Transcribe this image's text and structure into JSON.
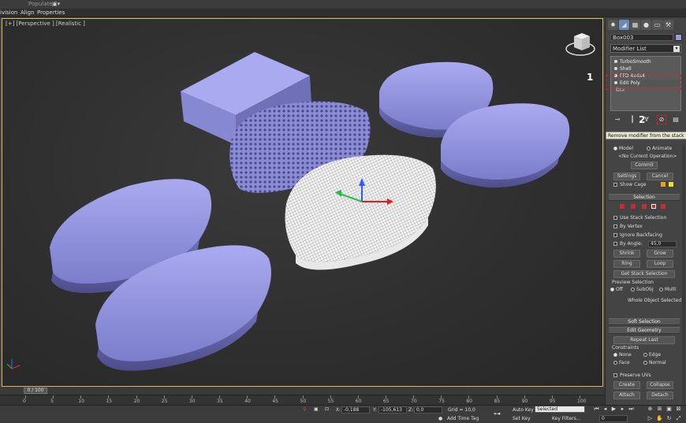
{
  "ribbon": {
    "populate": "Populate",
    "camera": "▣▾"
  },
  "menu": {
    "items": [
      "ivision",
      "Align",
      "Properties"
    ]
  },
  "viewport": {
    "label": "[+] [Perspective ] [Realistic ]",
    "selection_color": "#d6b95a",
    "object_color": "#8f90d6"
  },
  "panel": {
    "tabs": [
      "create-icon",
      "modify-icon",
      "hierarchy-icon",
      "motion-icon",
      "display-icon",
      "utilities-icon"
    ],
    "object_name": "Box003",
    "modifier_list": "Modifier List",
    "stack": [
      "TurboSmooth",
      "Shell",
      "FFD 4x4x4",
      "Edit Poly",
      "Box"
    ],
    "callout_1": "1",
    "callout_2": "2",
    "tooltip": "Remove modifier from the stack",
    "model_label": "Model",
    "animate_label": "Animate",
    "no_op": "<No Current Operation>",
    "commit": "Commit",
    "settings": "Settings",
    "cancel": "Cancel",
    "show_cage": "Show Cage",
    "selection_title": "Selection",
    "use_stack_selection": "Use Stack Selection",
    "by_vertex": "By Vertex",
    "ignore_backfacing": "Ignore Backfacing",
    "by_angle": "By Angle:",
    "by_angle_value": "45,0",
    "shrink": "Shrink",
    "grow": "Grow",
    "ring": "Ring",
    "loop": "Loop",
    "get_stack_selection": "Get Stack Selection",
    "preview_selection": "Preview Selection",
    "off": "Off",
    "subobj": "SubObj",
    "multi": "Multi",
    "whole_object": "Whole Object Selected",
    "soft_selection": "Soft Selection",
    "edit_geometry": "Edit Geometry",
    "repeat_last": "Repeat Last",
    "constraints": "Constraints",
    "none": "None",
    "edge": "Edge",
    "face": "Face",
    "normal": "Normal",
    "preserve_uvs": "Preserve UVs",
    "create": "Create",
    "collapse": "Collapse",
    "attach": "Attach",
    "detach": "Detach"
  },
  "timeline": {
    "frame": "0 / 100",
    "ticks": [
      0,
      5,
      10,
      15,
      20,
      25,
      30,
      35,
      40,
      45,
      50,
      55,
      60,
      65,
      70,
      75,
      80,
      85,
      90,
      95,
      100
    ]
  },
  "status": {
    "x_label": "X:",
    "x_value": "-0,188",
    "y_label": "Y:",
    "y_value": "-105,613",
    "z_label": "Z:",
    "z_value": "0,0",
    "grid": "Grid = 10,0",
    "auto_key": "Auto Key",
    "selected": "Selected",
    "set_key": "Set Key",
    "key_filters": "Key Filters...",
    "add_time_tag": "Add Time Tag",
    "frame_value": "0"
  }
}
